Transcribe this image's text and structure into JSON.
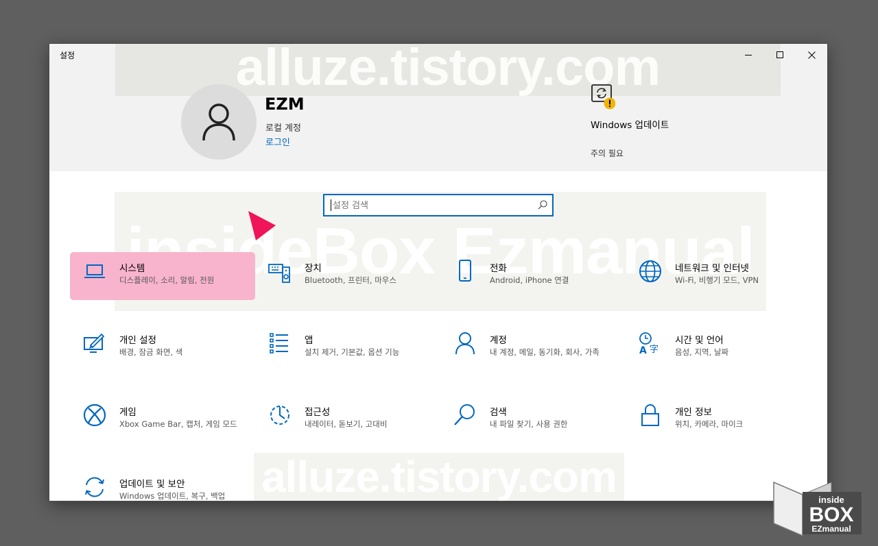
{
  "window": {
    "title": "설정"
  },
  "watermarks": [
    "alluze.tistory.com",
    "insideBox Ezmanual",
    "alluze.tistory.com"
  ],
  "account": {
    "name": "EZM",
    "type": "로컬 계정",
    "signin": "로그인"
  },
  "update": {
    "title": "Windows 업데이트",
    "status": "주의 필요"
  },
  "search": {
    "placeholder": "설정 검색"
  },
  "tiles": [
    {
      "title": "시스템",
      "subtitle": "디스플레이, 소리, 알림, 전원",
      "icon": "laptop-icon"
    },
    {
      "title": "장치",
      "subtitle": "Bluetooth, 프린터, 마우스",
      "icon": "devices-icon"
    },
    {
      "title": "전화",
      "subtitle": "Android, iPhone 연결",
      "icon": "phone-icon"
    },
    {
      "title": "네트워크 및 인터넷",
      "subtitle": "Wi-Fi, 비행기 모드, VPN",
      "icon": "globe-icon"
    },
    {
      "title": "개인 설정",
      "subtitle": "배경, 잠금 화면, 색",
      "icon": "personalization-icon"
    },
    {
      "title": "앱",
      "subtitle": "설치 제거, 기본값, 옵션 기능",
      "icon": "apps-list-icon"
    },
    {
      "title": "계정",
      "subtitle": "내 계정, 메일, 동기화, 회사, 가족",
      "icon": "person-icon"
    },
    {
      "title": "시간 및 언어",
      "subtitle": "음성, 지역, 날짜",
      "icon": "time-language-icon"
    },
    {
      "title": "게임",
      "subtitle": "Xbox Game Bar, 캡처, 게임 모드",
      "icon": "xbox-icon"
    },
    {
      "title": "접근성",
      "subtitle": "내레이터, 돋보기, 고대비",
      "icon": "accessibility-icon"
    },
    {
      "title": "검색",
      "subtitle": "내 파일 찾기, 사용 권한",
      "icon": "search-magnifier-icon"
    },
    {
      "title": "개인 정보",
      "subtitle": "위치, 카메라, 마이크",
      "icon": "lock-icon"
    },
    {
      "title": "업데이트 및 보안",
      "subtitle": "Windows 업데이트, 복구, 백업",
      "icon": "sync-icon"
    }
  ],
  "colors": {
    "accent": "#0067c0",
    "selected": "#f8b4cc",
    "annotation": "#f0145a",
    "header_bg": "#f2f2f2",
    "backdrop": "#5f5f5f"
  },
  "logo": {
    "line1": "inside",
    "line2": "BOX",
    "line3": "EZmanual"
  }
}
